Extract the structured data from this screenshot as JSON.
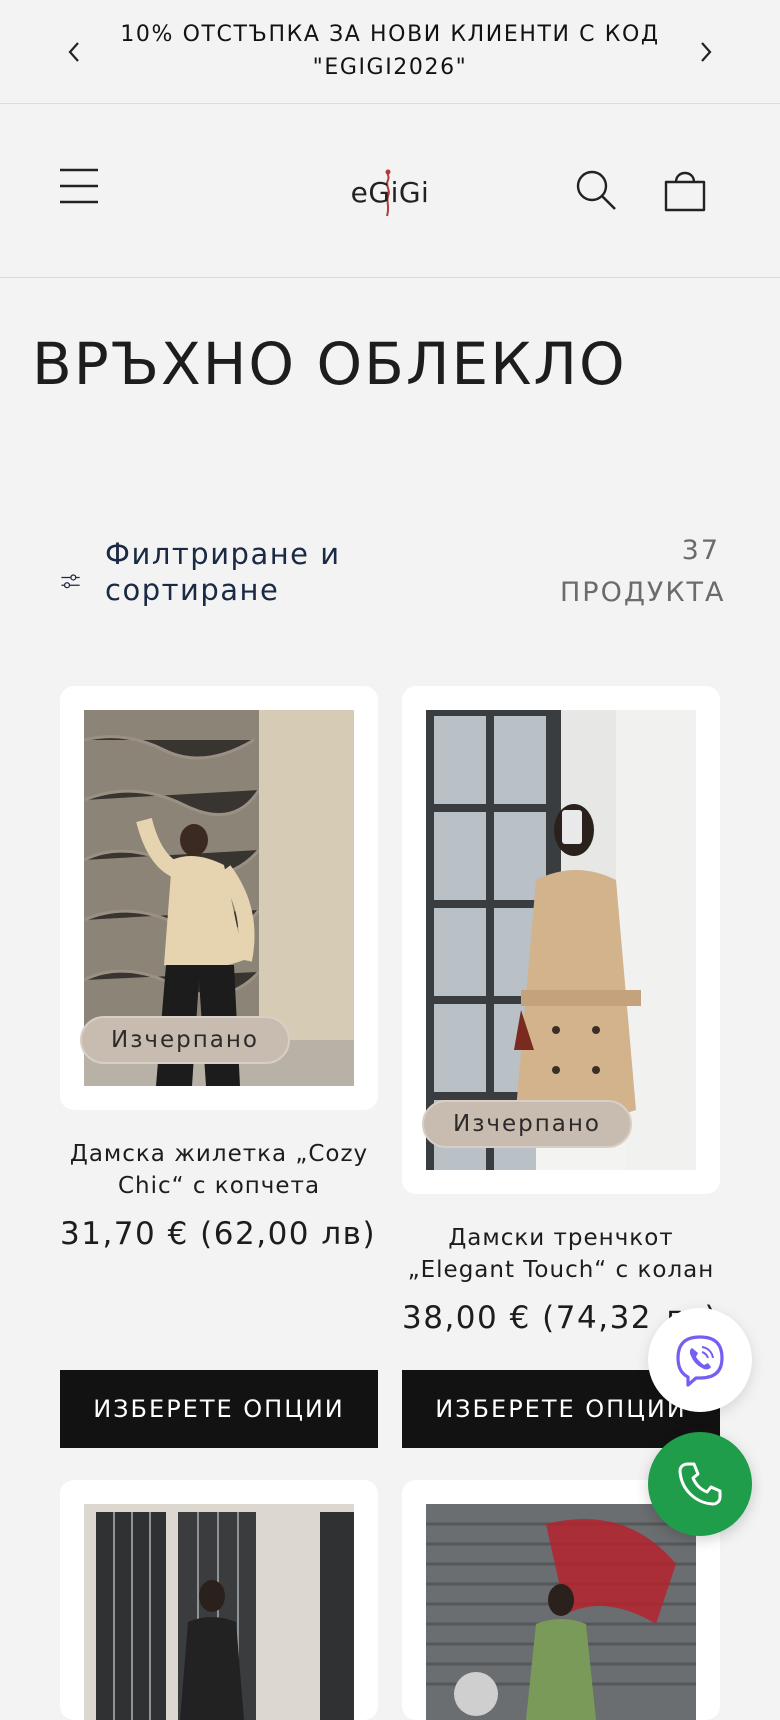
{
  "announcement": {
    "text": "10% ОТСТЪПКА ЗА НОВИ КЛИЕНТИ С КОД \"EGIGI2026\""
  },
  "header": {
    "logo_text": "eGiGi"
  },
  "collection": {
    "title": "ВРЪХНО ОБЛЕКЛО",
    "filter_label": "Филтриране и сортиране",
    "product_count": "37 ПРОДУКТА"
  },
  "products": [
    {
      "title": "Дамска жилетка „Cozy Chic“ с копчета",
      "price": "31,70 € (62,00 лв)",
      "badge": "Изчерпано",
      "button": "ИЗБЕРЕТЕ ОПЦИИ"
    },
    {
      "title": "Дамски тренчкот „Elegant Touch“ с колан",
      "price": "38,00 € (74,32 лв)",
      "badge": "Изчерпано",
      "button": "ИЗБЕРЕТЕ ОПЦИИ"
    }
  ],
  "colors": {
    "background": "#f3f3f3",
    "button": "#121212",
    "badge": "#c8bcb0",
    "viber": "#7360f2",
    "phone": "#1f9d4a"
  },
  "icons": [
    "chevron-left-icon",
    "chevron-right-icon",
    "menu-icon",
    "search-icon",
    "cart-icon",
    "filter-icon",
    "viber-icon",
    "phone-icon"
  ]
}
